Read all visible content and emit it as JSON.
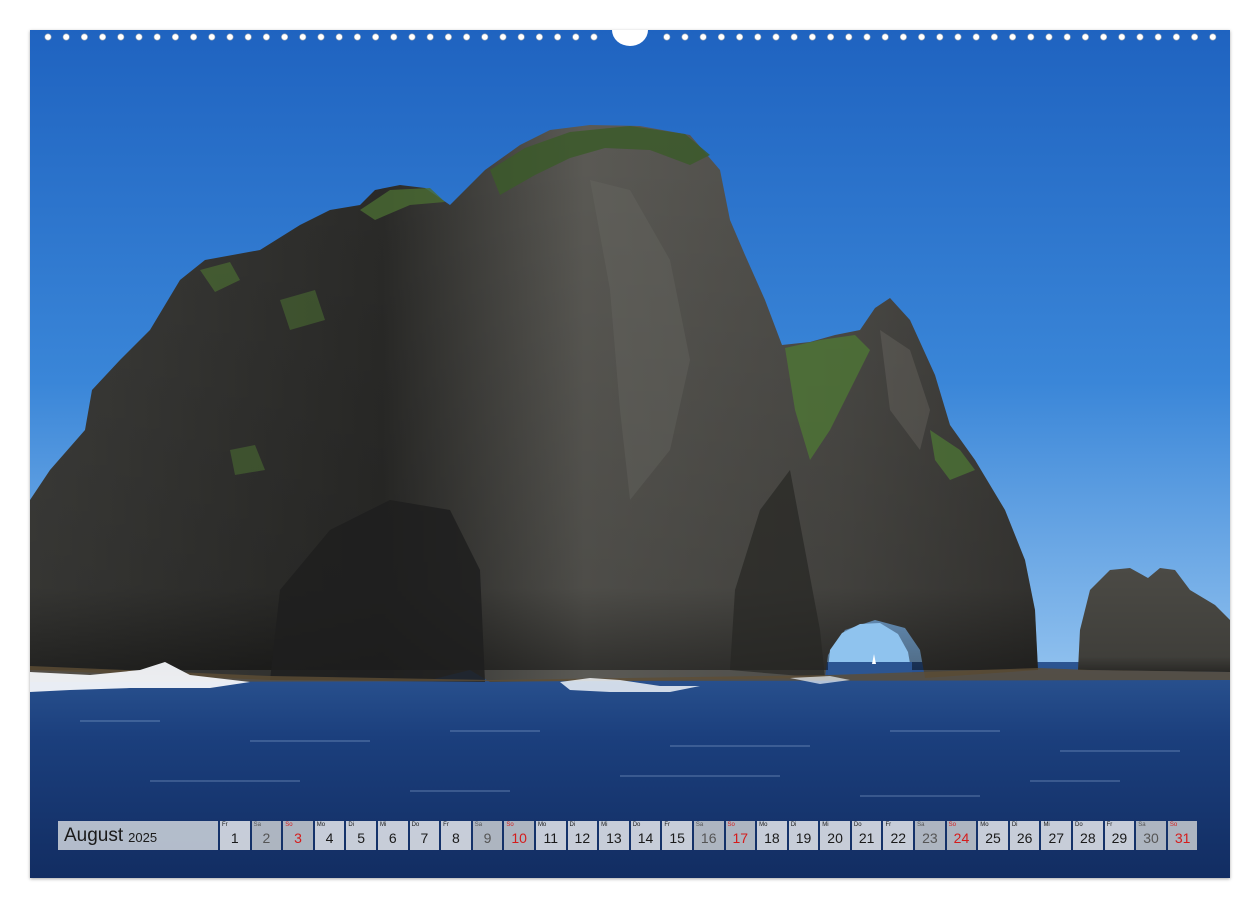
{
  "calendar": {
    "month": "August",
    "year": "2025",
    "days": [
      {
        "abbr": "Fr",
        "num": "1",
        "kind": "weekday"
      },
      {
        "abbr": "Sa",
        "num": "2",
        "kind": "sat"
      },
      {
        "abbr": "So",
        "num": "3",
        "kind": "sun"
      },
      {
        "abbr": "Mo",
        "num": "4",
        "kind": "weekday"
      },
      {
        "abbr": "Di",
        "num": "5",
        "kind": "weekday"
      },
      {
        "abbr": "Mi",
        "num": "6",
        "kind": "weekday"
      },
      {
        "abbr": "Do",
        "num": "7",
        "kind": "weekday"
      },
      {
        "abbr": "Fr",
        "num": "8",
        "kind": "weekday"
      },
      {
        "abbr": "Sa",
        "num": "9",
        "kind": "sat"
      },
      {
        "abbr": "So",
        "num": "10",
        "kind": "sun"
      },
      {
        "abbr": "Mo",
        "num": "11",
        "kind": "weekday"
      },
      {
        "abbr": "Di",
        "num": "12",
        "kind": "weekday"
      },
      {
        "abbr": "Mi",
        "num": "13",
        "kind": "weekday"
      },
      {
        "abbr": "Do",
        "num": "14",
        "kind": "weekday"
      },
      {
        "abbr": "Fr",
        "num": "15",
        "kind": "weekday"
      },
      {
        "abbr": "Sa",
        "num": "16",
        "kind": "sat"
      },
      {
        "abbr": "So",
        "num": "17",
        "kind": "sun"
      },
      {
        "abbr": "Mo",
        "num": "18",
        "kind": "weekday"
      },
      {
        "abbr": "Di",
        "num": "19",
        "kind": "weekday"
      },
      {
        "abbr": "Mi",
        "num": "20",
        "kind": "weekday"
      },
      {
        "abbr": "Do",
        "num": "21",
        "kind": "weekday"
      },
      {
        "abbr": "Fr",
        "num": "22",
        "kind": "weekday"
      },
      {
        "abbr": "Sa",
        "num": "23",
        "kind": "sat"
      },
      {
        "abbr": "So",
        "num": "24",
        "kind": "sun"
      },
      {
        "abbr": "Mo",
        "num": "25",
        "kind": "weekday"
      },
      {
        "abbr": "Di",
        "num": "26",
        "kind": "weekday"
      },
      {
        "abbr": "Mi",
        "num": "27",
        "kind": "weekday"
      },
      {
        "abbr": "Do",
        "num": "28",
        "kind": "weekday"
      },
      {
        "abbr": "Fr",
        "num": "29",
        "kind": "weekday"
      },
      {
        "abbr": "Sa",
        "num": "30",
        "kind": "sat"
      },
      {
        "abbr": "So",
        "num": "31",
        "kind": "sun"
      }
    ]
  },
  "colors": {
    "sky": "#2a73c8",
    "sea": "#163a78",
    "rock": "#4a4a47",
    "sunday": "#d41c1c"
  },
  "icons": {
    "binding": "wire-binding-icon"
  }
}
